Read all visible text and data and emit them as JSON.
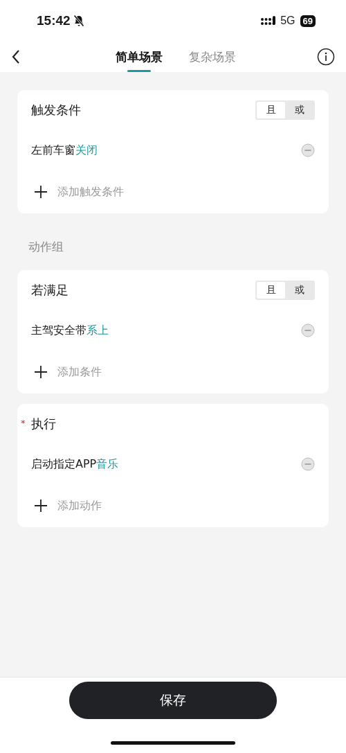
{
  "status_bar": {
    "time": "15:42",
    "network": "5G",
    "battery": "69"
  },
  "nav": {
    "tabs": [
      {
        "label": "简单场景",
        "selected": true
      },
      {
        "label": "复杂场景",
        "selected": false
      }
    ]
  },
  "sections": [
    {
      "kind": "card",
      "title": "触发条件",
      "logic": [
        {
          "label": "且",
          "selected": true
        },
        {
          "label": "或",
          "selected": false
        }
      ],
      "items": [
        {
          "subject": "左前车窗",
          "value": "关闭"
        }
      ],
      "add_label": "添加触发条件"
    },
    {
      "kind": "label",
      "title": "动作组"
    },
    {
      "kind": "card",
      "title": "若满足",
      "logic": [
        {
          "label": "且",
          "selected": true
        },
        {
          "label": "或",
          "selected": false
        }
      ],
      "items": [
        {
          "subject": "主驾安全带",
          "value": "系上"
        }
      ],
      "add_label": "添加条件"
    },
    {
      "kind": "card",
      "title": "执行",
      "required_mark": "*",
      "items": [
        {
          "subject": "启动指定APP",
          "value": "音乐"
        }
      ],
      "add_label": "添加动作"
    }
  ],
  "save_button": "保存"
}
